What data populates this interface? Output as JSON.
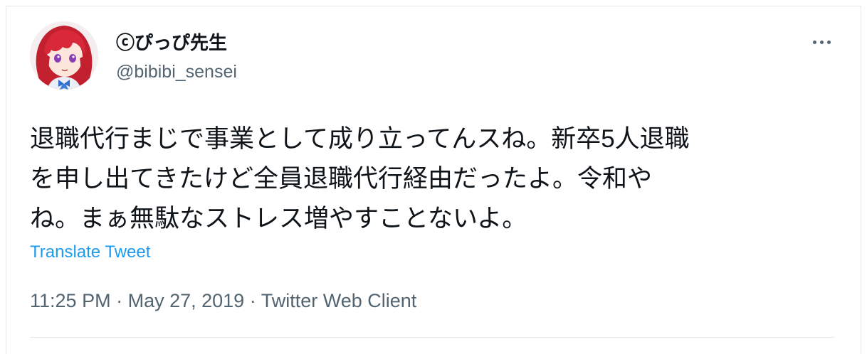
{
  "author": {
    "display_name": "ⓒぴっぴ先生",
    "handle": "@bibibi_sensei"
  },
  "tweet": {
    "lines": [
      "退職代行まじで事業として成り立ってんスね。新卒5人退職",
      "を申し出てきたけど全員退職代行経由だったよ。令和や",
      "ね。まぁ無駄なストレス増やすことないよ。"
    ],
    "translate_label": "Translate Tweet"
  },
  "meta": {
    "time": "11:25 PM",
    "separator": "·",
    "date": "May 27, 2019",
    "client": "Twitter Web Client"
  },
  "icons": {
    "more": "more-dots-icon",
    "avatar": "avatar-image"
  },
  "colors": {
    "link": "#1d9bf0",
    "secondary_text": "#536471",
    "primary_text": "#0f1419",
    "border": "#e1e8ed"
  }
}
